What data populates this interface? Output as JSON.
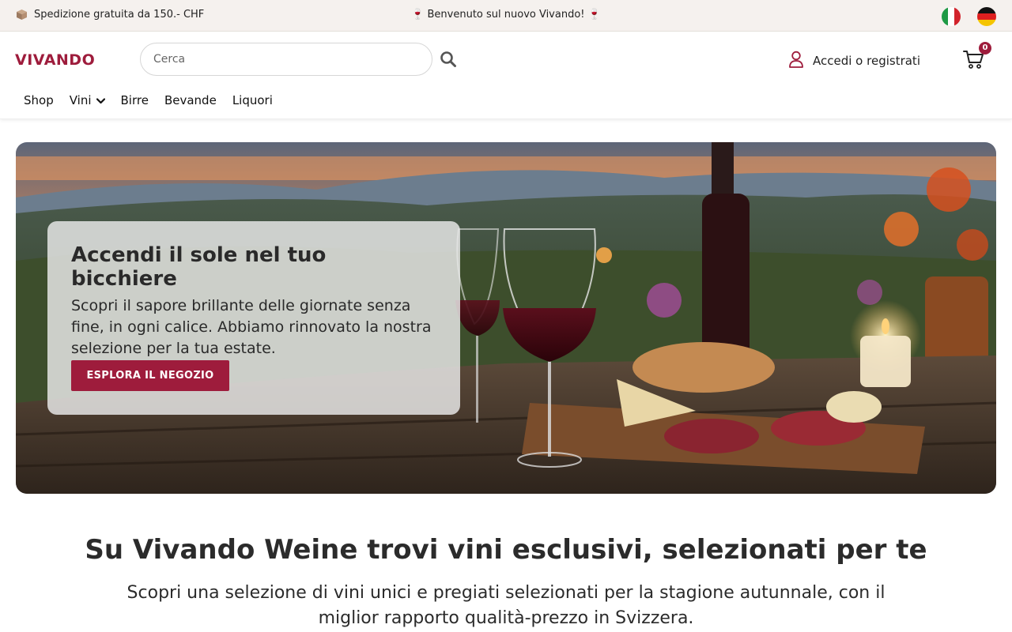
{
  "topbar": {
    "shipping": "Spedizione gratuita da 150.- CHF",
    "shipping_icon": "package-icon",
    "welcome": "🍷 Benvenuto sul nuovo Vivando! 🍷",
    "languages": [
      "italian-flag",
      "german-flag"
    ]
  },
  "header": {
    "logo": "VIVANDO",
    "search": {
      "placeholder": "Cerca",
      "value": ""
    },
    "account_label": "Accedi o registrati",
    "cart_count": "0"
  },
  "nav": {
    "items": [
      "Shop",
      "Vini",
      "Birre",
      "Bevande",
      "Liquori"
    ]
  },
  "hero": {
    "title": "Accendi il sole nel tuo bicchiere",
    "text": "Scopri il sapore brillante delle giornate senza fine, in ogni calice. Abbiamo rinnovato la nostra selezione per la tua estate.",
    "button": "ESPLORA IL NEGOZIO"
  },
  "intro": {
    "title": "Su Vivando Weine trovi vini esclusivi, selezionati per te",
    "text": "Scopri una selezione di vini unici e pregiati selezionati per la stagione autunnale, con il miglior rapporto qualità-prezzo in Svizzera."
  },
  "colors": {
    "brand": "#9e1c3c",
    "topbar_bg": "#f5f1ee"
  }
}
